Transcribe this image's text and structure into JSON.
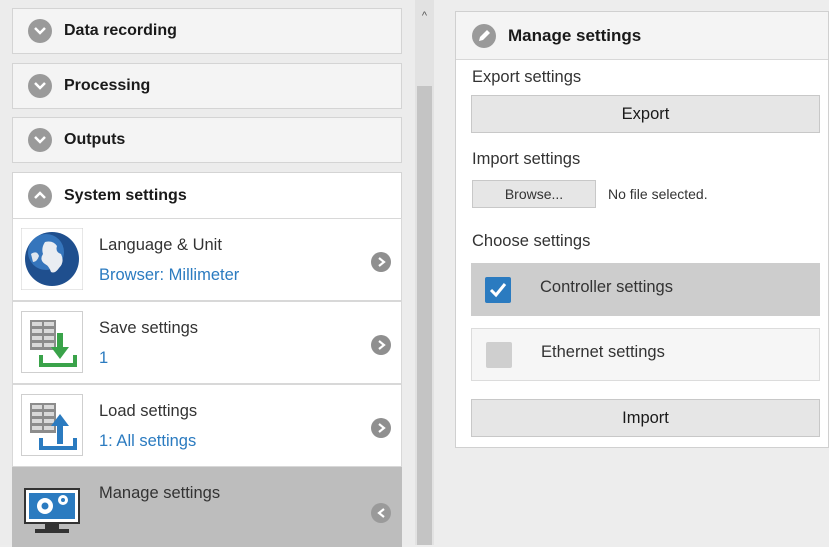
{
  "sidebar": {
    "sections": [
      {
        "title": "Data recording",
        "state": "collapsed"
      },
      {
        "title": "Processing",
        "state": "collapsed"
      },
      {
        "title": "Outputs",
        "state": "collapsed"
      },
      {
        "title": "System settings",
        "state": "expanded"
      }
    ],
    "items": [
      {
        "label": "Language & Unit",
        "value": "Browser: Millimeter",
        "icon": "globe-icon"
      },
      {
        "label": "Save settings",
        "value": "1",
        "icon": "save-settings-icon"
      },
      {
        "label": "Load settings",
        "value": "1: All settings",
        "icon": "load-settings-icon"
      },
      {
        "label": "Manage settings",
        "value": "",
        "icon": "manage-settings-icon",
        "active": true
      }
    ]
  },
  "panel": {
    "title": "Manage settings",
    "export_heading": "Export settings",
    "export_button": "Export",
    "import_heading": "Import settings",
    "browse_button": "Browse...",
    "file_status": "No file selected.",
    "choose_heading": "Choose settings",
    "choices": [
      {
        "label": "Controller settings",
        "checked": true
      },
      {
        "label": "Ethernet settings",
        "checked": false
      }
    ],
    "import_button": "Import"
  },
  "colors": {
    "accent": "#2b7bc0",
    "active_item_bg": "#bdbdbd"
  }
}
